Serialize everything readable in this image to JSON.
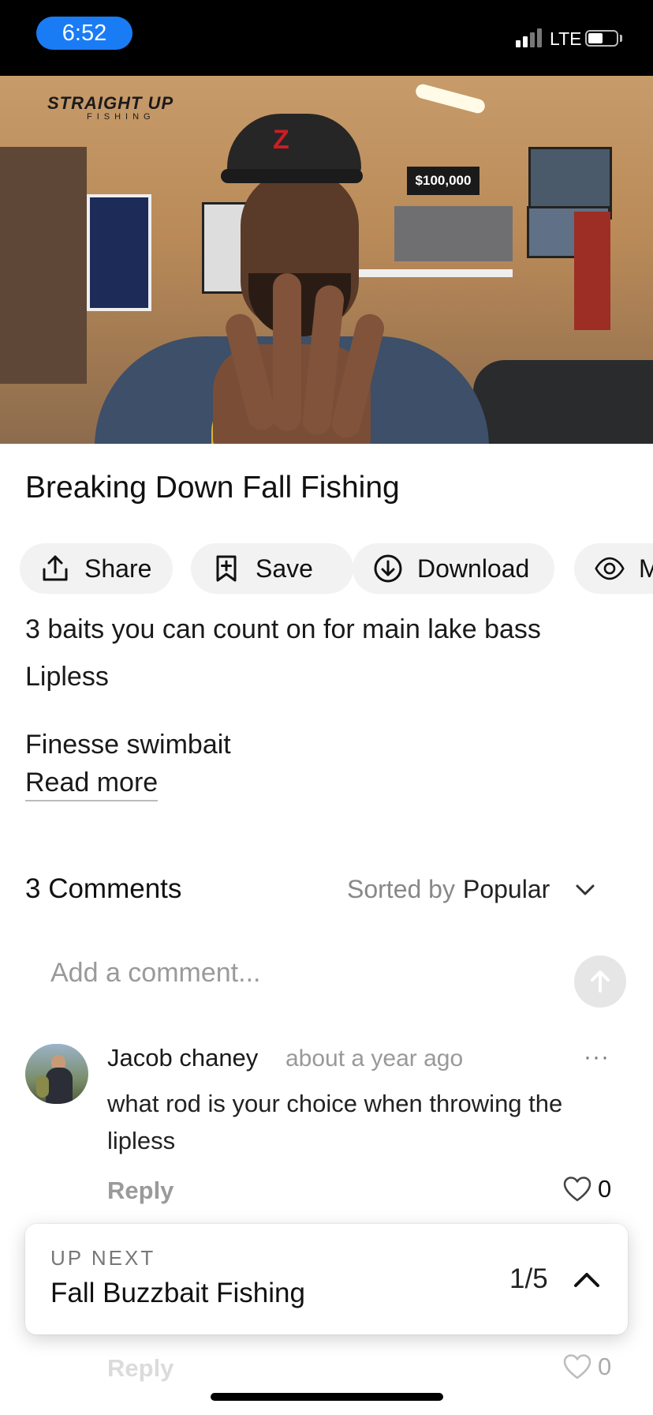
{
  "status_bar": {
    "time": "6:52",
    "carrier": "LTE"
  },
  "video": {
    "channel_logo": "STRAIGHT UP",
    "channel_logo_sub": "FISHING",
    "sign_text": "$100,000"
  },
  "title": "Breaking Down Fall Fishing",
  "actions": [
    {
      "label": "Share",
      "icon": "share-icon"
    },
    {
      "label": "Save",
      "icon": "bookmark-plus-icon"
    },
    {
      "label": "Download",
      "icon": "download-icon"
    },
    {
      "label": "M",
      "icon": "eye-icon"
    }
  ],
  "description": {
    "lines": [
      "3 baits you can count on for main lake bass",
      "Lipless",
      "Finesse swimbait"
    ],
    "read_more": "Read more"
  },
  "comments": {
    "count_label": "3 Comments",
    "sorted_by_label": "Sorted by",
    "sort_value": "Popular",
    "add_placeholder": "Add a comment...",
    "items": [
      {
        "author": "Jacob chaney",
        "time": "about a year ago",
        "text": "what rod is your choice when throwing the lipless",
        "reply_label": "Reply",
        "likes": "0",
        "more": "···"
      },
      {
        "reply_label": "Reply",
        "likes": "0"
      }
    ]
  },
  "up_next": {
    "label": "UP NEXT",
    "title": "Fall Buzzbait Fishing",
    "position": "1/5"
  }
}
